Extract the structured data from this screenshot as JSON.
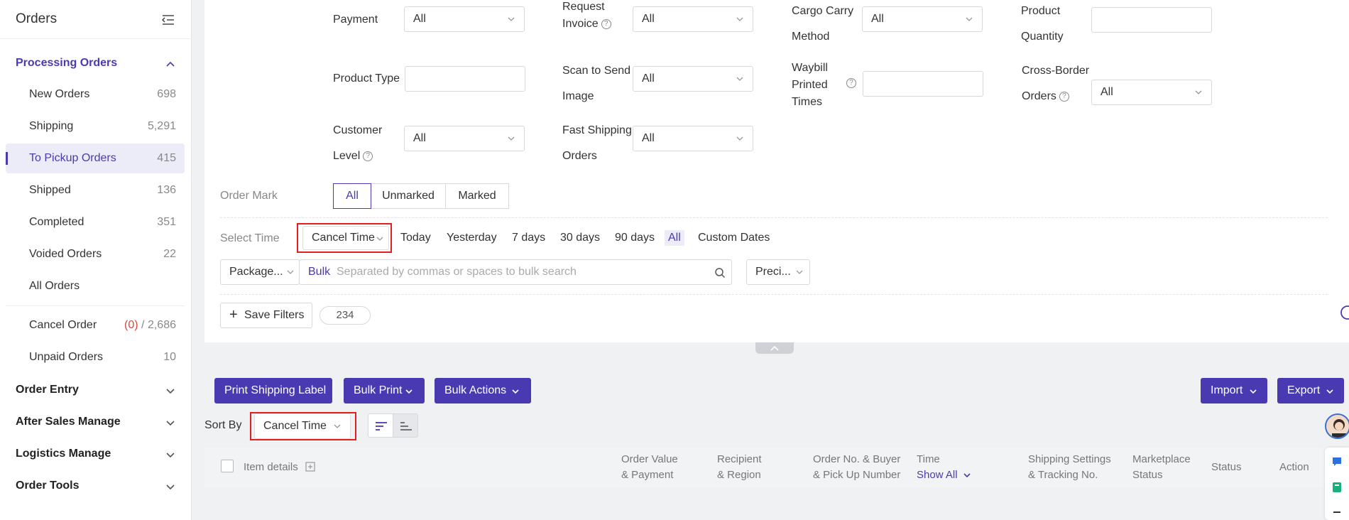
{
  "sidebar": {
    "title": "Orders",
    "processing": {
      "label": "Processing Orders",
      "items": [
        {
          "label": "New Orders",
          "count": "698"
        },
        {
          "label": "Shipping",
          "count": "5,291"
        },
        {
          "label": "To Pickup Orders",
          "count": "415"
        },
        {
          "label": "Shipped",
          "count": "136"
        },
        {
          "label": "Completed",
          "count": "351"
        },
        {
          "label": "Voided Orders",
          "count": "22"
        },
        {
          "label": "All Orders",
          "count": ""
        }
      ],
      "cancel": {
        "label": "Cancel Order",
        "count_open": "(0)",
        "count_sep": " / ",
        "count_total": "2,686"
      },
      "unpaid": {
        "label": "Unpaid Orders",
        "count": "10"
      }
    },
    "sections": [
      "Order Entry",
      "After Sales Manage",
      "Logistics Manage",
      "Order Tools"
    ]
  },
  "filters": {
    "payment": {
      "label": "Payment",
      "value": "All"
    },
    "request_invoice": {
      "label1": "Request",
      "label2": "Invoice",
      "value": "All"
    },
    "cargo": {
      "label1": "Cargo Carry",
      "label2": "Method",
      "value": "All"
    },
    "product_qty": {
      "label1": "Product",
      "label2": "Quantity"
    },
    "product_type": {
      "label": "Product Type"
    },
    "scan_send": {
      "label1": "Scan to Send",
      "label2": "Image",
      "value": "All"
    },
    "waybill": {
      "label1": "Waybill",
      "label2": "Printed",
      "label3": "Times"
    },
    "cross_border": {
      "label1": "Cross-Border",
      "label2": "Orders",
      "value": "All"
    },
    "customer_level": {
      "label1": "Customer",
      "label2": "Level",
      "value": "All"
    },
    "fast_shipping": {
      "label1": "Fast Shipping",
      "label2": "Orders",
      "value": "All"
    },
    "order_mark": {
      "label": "Order Mark",
      "options": [
        "All",
        "Unmarked",
        "Marked"
      ]
    },
    "select_time": {
      "label": "Select Time",
      "field": "Cancel Time",
      "options": [
        "Today",
        "Yesterday",
        "7 days",
        "30 days",
        "90 days",
        "All",
        "Custom Dates"
      ]
    },
    "search": {
      "type": "Package...",
      "bulk": "Bulk",
      "placeholder": "Separated by commas or spaces to bulk search",
      "mode": "Preci..."
    },
    "save_filters": "Save Filters",
    "saved_count": "234"
  },
  "toolbar": {
    "print_label": "Print Shipping Label",
    "bulk_print": "Bulk Print",
    "bulk_actions": "Bulk Actions",
    "import": "Import",
    "export": "Export",
    "sort_by": "Sort By",
    "sort_field": "Cancel Time"
  },
  "table": {
    "item_details": "Item details",
    "cols": [
      {
        "l1": "Order Value",
        "l2": "& Payment"
      },
      {
        "l1": "Recipient",
        "l2": "& Region"
      },
      {
        "l1": "Order No. & Buyer",
        "l2": "& Pick Up Number"
      },
      {
        "l1": "Time",
        "l2": "Show All"
      },
      {
        "l1": "Shipping Settings",
        "l2": "& Tracking No."
      },
      {
        "l1": "Marketplace",
        "l2": "Status"
      },
      {
        "l1": "Status",
        "l2": ""
      },
      {
        "l1": "Action",
        "l2": ""
      }
    ]
  },
  "colors": {
    "accent": "#4a3ab2",
    "highlight": "#e02020"
  }
}
